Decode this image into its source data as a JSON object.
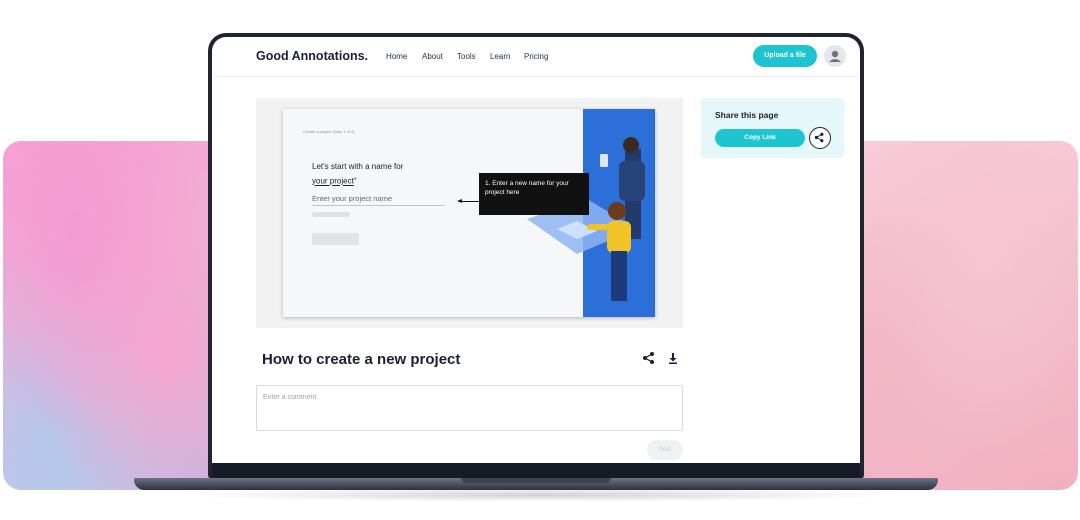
{
  "nav": {
    "brand": "Good Annotations.",
    "links": [
      "Home",
      "About",
      "Tools",
      "Learn",
      "Pricing"
    ],
    "upload_label": "Upload a file",
    "avatar_icon": "user-icon"
  },
  "preview": {
    "step_text": "Create a project (Step 1 of 3)",
    "heading_line1": "Let's start with a name for",
    "heading_line2": "your project",
    "heading_sup": "®",
    "input_placeholder": "Enter your project name",
    "callout_text": "1. Enter a new name for your project here"
  },
  "document": {
    "title": "How to create a new project",
    "share_icon": "share-icon",
    "download_icon": "download-icon"
  },
  "comment": {
    "placeholder": "Enter a comment",
    "post_label": "Post"
  },
  "share_card": {
    "title": "Share this page",
    "copy_label": "Copy Link",
    "icon": "share-icon"
  },
  "colors": {
    "accent": "#1ec5d0",
    "navy": "#1a1f36",
    "illustration_blue": "#2d6fd9",
    "share_card_bg": "#e6f7f9"
  }
}
